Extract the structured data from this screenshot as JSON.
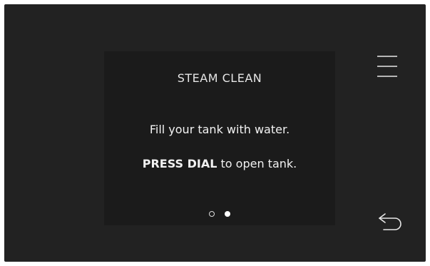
{
  "card": {
    "title": "STEAM CLEAN",
    "line1": "Fill your tank with water.",
    "line2_bold": "PRESS DIAL",
    "line2_rest": " to open tank."
  },
  "pagination": {
    "current_page": 2,
    "total_pages": 2
  },
  "icons": {
    "menu": "hamburger-menu-icon",
    "back": "back-arrow-icon"
  },
  "colors": {
    "background": "#222222",
    "card": "#1b1b1b",
    "text": "#f2f2f2"
  }
}
